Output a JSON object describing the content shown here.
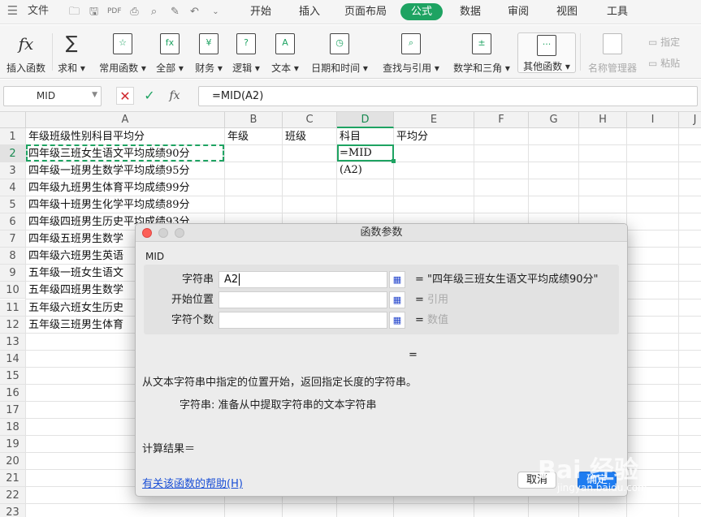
{
  "quick_access": {
    "file_label": "文件"
  },
  "tabs": [
    {
      "label": "开始"
    },
    {
      "label": "插入"
    },
    {
      "label": "页面布局"
    },
    {
      "label": "公式"
    },
    {
      "label": "数据"
    },
    {
      "label": "审阅"
    },
    {
      "label": "视图"
    },
    {
      "label": "工具"
    }
  ],
  "ribbon": {
    "insert_function": "插入函数",
    "sum": "求和",
    "common_functions": "常用函数",
    "all": "全部",
    "financial": "财务",
    "logical": "逻辑",
    "text": "文本",
    "date_time": "日期和时间",
    "lookup_reference": "查找与引用",
    "math_trig": "数学和三角",
    "other_functions": "其他函数",
    "name_manager": "名称管理器",
    "define": "指定",
    "paste": "粘贴"
  },
  "formula_bar": {
    "name_box": "MID",
    "formula": "=MID(A2)"
  },
  "sheet": {
    "columns": [
      "A",
      "B",
      "C",
      "D",
      "E",
      "F",
      "G",
      "H",
      "I",
      "J"
    ],
    "rows": [
      "1",
      "2",
      "3",
      "4",
      "5",
      "6",
      "7",
      "8",
      "9",
      "10",
      "11",
      "12",
      "13",
      "14",
      "15",
      "16",
      "17",
      "18",
      "19",
      "20",
      "21",
      "22",
      "23"
    ],
    "header_row": {
      "A": "年级班级性别科目平均分",
      "B": "年级",
      "C": "班级",
      "D": "科目",
      "E": "平均分"
    },
    "col_a": [
      "四年级三班女生语文平均成绩90分",
      "四年级一班男生数学平均成绩95分",
      "四年级九班男生体育平均成绩99分",
      "四年级十班男生化学平均成绩89分",
      "四年级四班男生历史平均成绩93分",
      "四年级五班男生数学",
      "四年级六班男生英语",
      "五年级一班女生语文",
      "五年级四班男生数学",
      "五年级六班女生历史",
      "五年级三班男生体育"
    ],
    "d2": "=MID",
    "d3": "(A2)"
  },
  "dialog": {
    "title": "函数参数",
    "function_name": "MID",
    "args": [
      {
        "label": "字符串",
        "value": "A2",
        "result": "\"四年级三班女生语文平均成绩90分\""
      },
      {
        "label": "开始位置",
        "value": "",
        "result": "引用"
      },
      {
        "label": "字符个数",
        "value": "",
        "result": "数值"
      }
    ],
    "result_eq": "=",
    "description": "从文本字符串中指定的位置开始，返回指定长度的字符串。",
    "arg_description": "字符串: 准备从中提取字符串的文本字符串",
    "calc_result": "计算结果＝",
    "help_link": "有关该函数的帮助(H)",
    "cancel": "取消",
    "ok": "确定"
  },
  "watermark": {
    "text": "Bai 经验",
    "sub": "jingyan.baidu.com"
  },
  "colors": {
    "accent": "#1ea362",
    "ok_button": "#1f7cf0",
    "link": "#1a4fd6"
  }
}
